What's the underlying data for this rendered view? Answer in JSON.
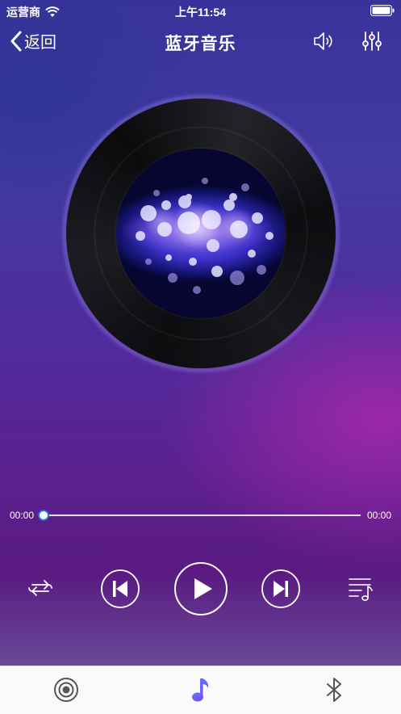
{
  "status_bar": {
    "carrier": "运营商",
    "time": "上午11:54"
  },
  "nav": {
    "back_label": "返回",
    "title": "蓝牙音乐",
    "right_icons": [
      "volume-icon",
      "equalizer-icon"
    ]
  },
  "player": {
    "elapsed": "00:00",
    "duration": "00:00",
    "progress": 0,
    "controls": [
      "repeat-icon",
      "previous-icon",
      "play-icon",
      "next-icon",
      "playlist-icon"
    ]
  },
  "tab_bar": {
    "tabs": [
      {
        "icon": "radio-icon",
        "active": false
      },
      {
        "icon": "music-note-icon",
        "active": true
      },
      {
        "icon": "bluetooth-icon",
        "active": false
      }
    ]
  },
  "colors": {
    "accent": "#2a6fe0",
    "tab_active_start": "#5b7cff",
    "tab_active_end": "#8a3ef0"
  }
}
